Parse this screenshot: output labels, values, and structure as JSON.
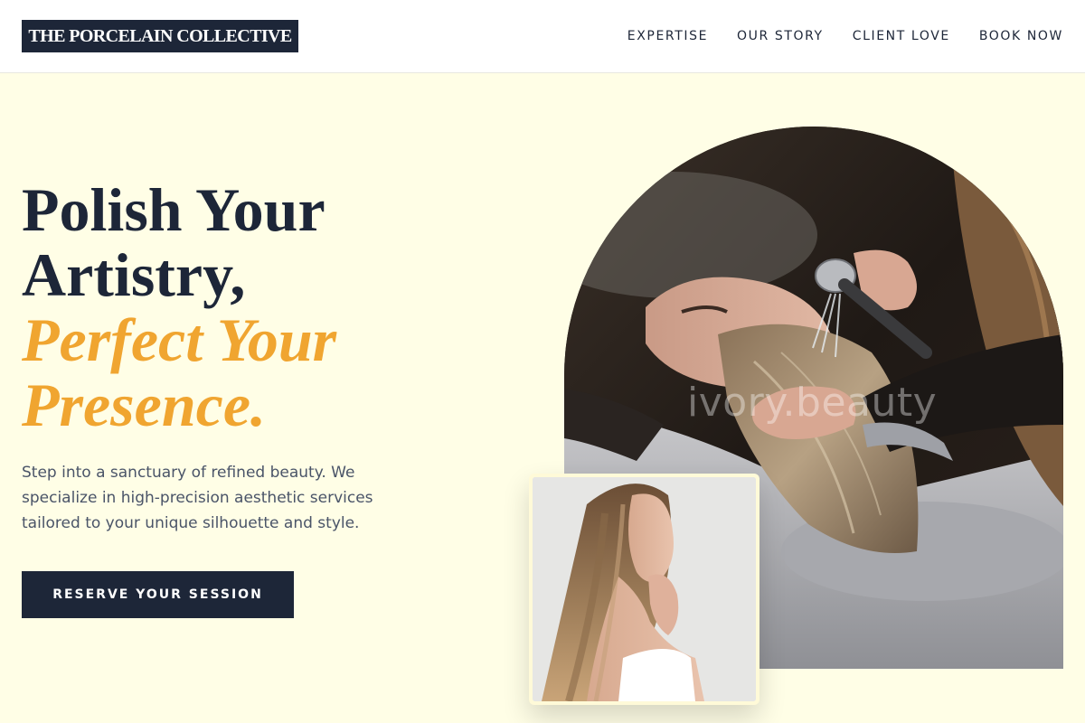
{
  "brand": {
    "name": "THE PORCELAIN COLLECTIVE"
  },
  "nav": {
    "items": [
      {
        "label": "EXPERTISE"
      },
      {
        "label": "OUR STORY"
      },
      {
        "label": "CLIENT LOVE"
      },
      {
        "label": "BOOK NOW"
      }
    ]
  },
  "hero": {
    "headline_line1": "Polish Your",
    "headline_line2": "Artistry,",
    "headline_accent1": "Perfect Your",
    "headline_accent2": "Presence.",
    "intro": "Step into a sanctuary of refined beauty. We specialize in high-precision aesthetic services tailored to your unique silhouette and style.",
    "cta_label": "RESERVE YOUR SESSION"
  },
  "media": {
    "main_photo_watermark": "ivory.beauty"
  },
  "colors": {
    "navy": "#1d2638",
    "accent": "#f0a530",
    "background": "#fffee6",
    "body_text": "#4a5468"
  }
}
